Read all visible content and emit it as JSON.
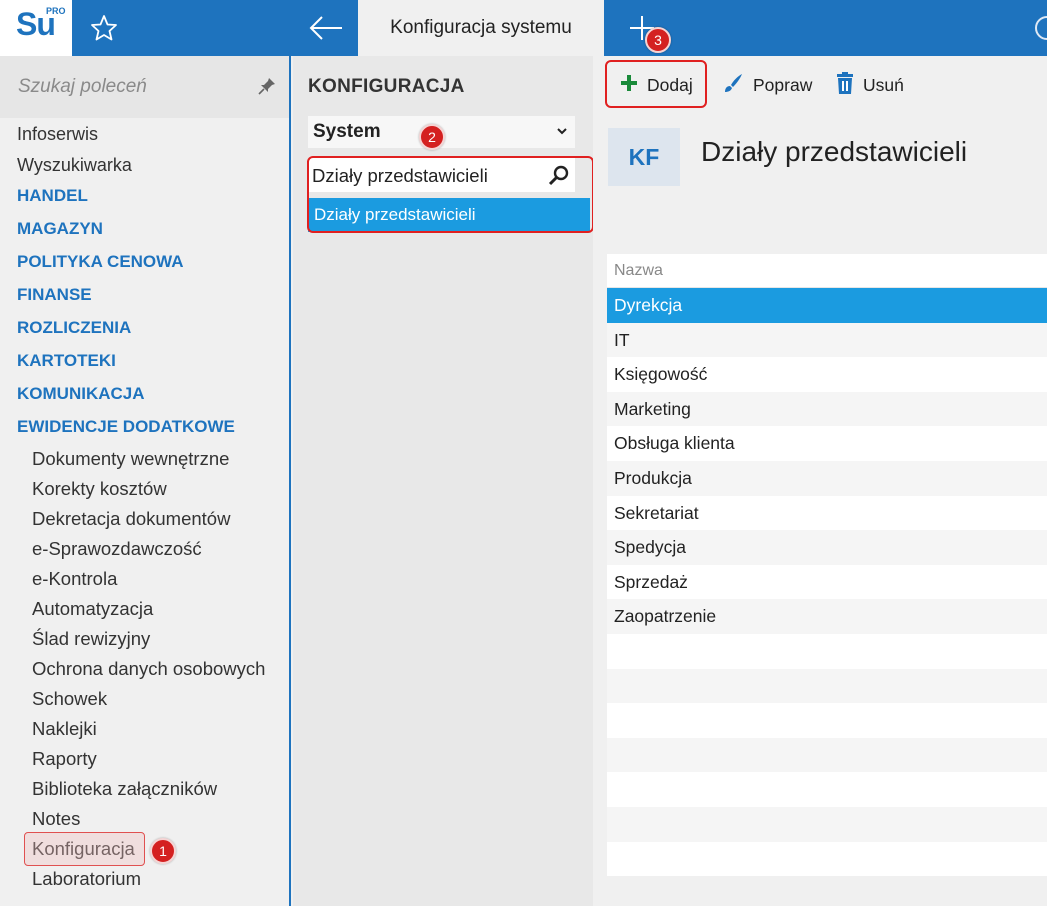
{
  "app": {
    "logo_text": "Su",
    "logo_sup": "PRO",
    "active_tab": "Konfiguracja systemu"
  },
  "left_panel": {
    "search_placeholder": "Szukaj poleceń",
    "items": [
      {
        "label": "Infoserwis",
        "type": "item"
      },
      {
        "label": "Wyszukiwarka",
        "type": "item"
      },
      {
        "label": "HANDEL",
        "type": "group"
      },
      {
        "label": "MAGAZYN",
        "type": "group"
      },
      {
        "label": "POLITYKA CENOWA",
        "type": "group"
      },
      {
        "label": "FINANSE",
        "type": "group"
      },
      {
        "label": "ROZLICZENIA",
        "type": "group"
      },
      {
        "label": "KARTOTEKI",
        "type": "group"
      },
      {
        "label": "KOMUNIKACJA",
        "type": "group"
      },
      {
        "label": "EWIDENCJE DODATKOWE",
        "type": "group"
      },
      {
        "label": "Dokumenty wewnętrzne",
        "type": "sub"
      },
      {
        "label": "Korekty kosztów",
        "type": "sub"
      },
      {
        "label": "Dekretacja dokumentów",
        "type": "sub"
      },
      {
        "label": "e-Sprawozdawczość",
        "type": "sub"
      },
      {
        "label": "e-Kontrola",
        "type": "sub"
      },
      {
        "label": "Automatyzacja",
        "type": "sub"
      },
      {
        "label": "Ślad rewizyjny",
        "type": "sub"
      },
      {
        "label": "Ochrona danych osobowych",
        "type": "sub"
      },
      {
        "label": "Schowek",
        "type": "sub"
      },
      {
        "label": "Naklejki",
        "type": "sub"
      },
      {
        "label": "Raporty",
        "type": "sub"
      },
      {
        "label": "Biblioteka załączników",
        "type": "sub"
      },
      {
        "label": "Notes",
        "type": "sub"
      },
      {
        "label": "Konfiguracja",
        "type": "sub"
      },
      {
        "label": "Laboratorium",
        "type": "sub"
      }
    ]
  },
  "middle_panel": {
    "title": "KONFIGURACJA",
    "select_value": "System",
    "search_value": "Działy przedstawicieli",
    "selected_result": "Działy przedstawicieli"
  },
  "toolbar": {
    "add_label": "Dodaj",
    "edit_label": "Popraw",
    "delete_label": "Usuń"
  },
  "detail": {
    "badge": "KF",
    "title": "Działy przedstawicieli"
  },
  "grid": {
    "header": "Nazwa",
    "rows": [
      "Dyrekcja",
      "IT",
      "Księgowość",
      "Marketing",
      "Obsługa klienta",
      "Produkcja",
      "Sekretariat",
      "Spedycja",
      "Sprzedaż",
      "Zaopatrzenie"
    ],
    "selected_index": 0
  },
  "annotations": {
    "badge1": "1",
    "badge2": "2",
    "badge3": "3"
  },
  "colors": {
    "brand_blue": "#1e73be",
    "selection_blue": "#1b9be0",
    "annotation_red": "#e02020",
    "add_green": "#1a8a3a"
  }
}
